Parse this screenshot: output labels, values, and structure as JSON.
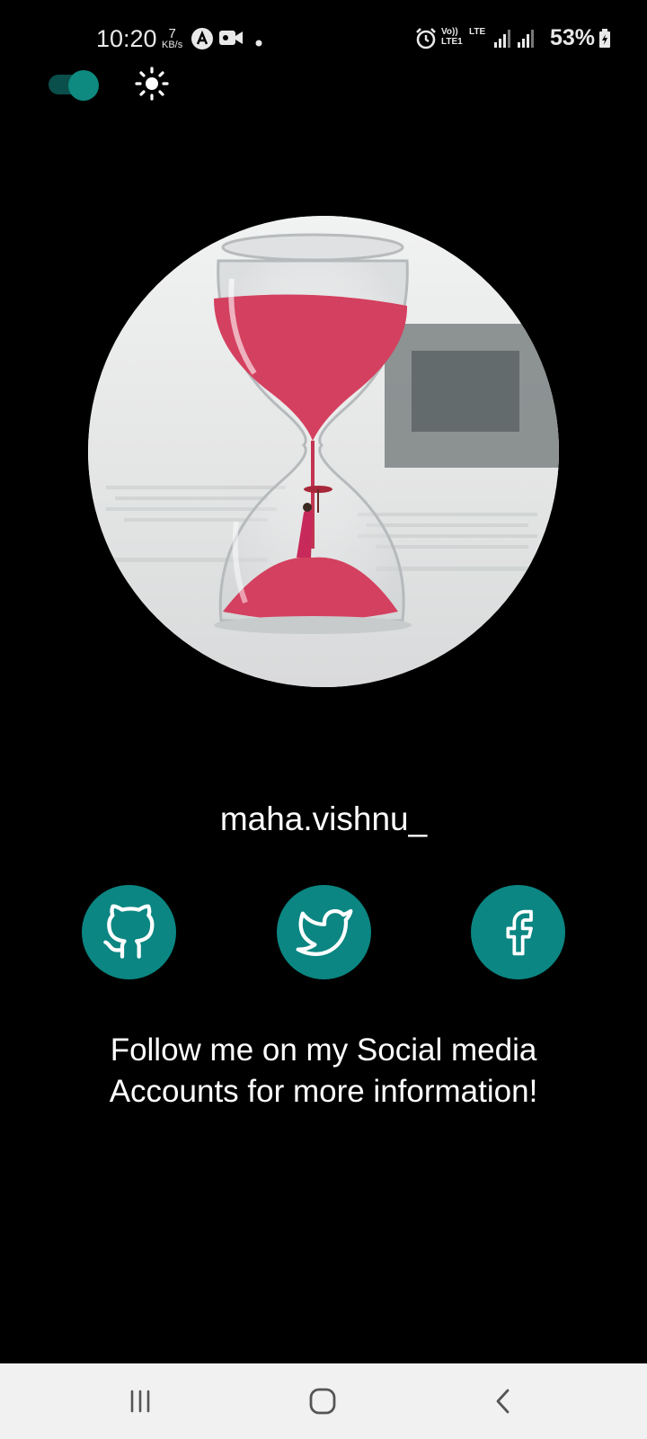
{
  "status_bar": {
    "time": "10:20",
    "speed_value": "7",
    "speed_unit": "KB/s",
    "battery": "53%",
    "icons": [
      "a-icon",
      "video-icon",
      "dot-icon",
      "alarm-icon",
      "volte-icon",
      "lte-icon",
      "signal-icon",
      "signal-icon",
      "battery-charging-icon"
    ],
    "volte_label": "Vo)) LTE1",
    "lte_label": "LTE"
  },
  "header": {
    "theme_toggle": "on",
    "theme_icon": "sun-icon"
  },
  "profile": {
    "image": "hourglass-photo",
    "username": "maha.vishnu_"
  },
  "social": [
    {
      "name": "GitHub",
      "icon": "github-icon"
    },
    {
      "name": "Twitter",
      "icon": "twitter-icon"
    },
    {
      "name": "Facebook",
      "icon": "facebook-icon"
    }
  ],
  "message": "Follow me on my Social media Accounts for more information!",
  "nav": [
    "recent-apps-icon",
    "home-icon",
    "back-icon"
  ],
  "colors": {
    "accent": "#0b8682",
    "background": "#000000",
    "sand": "#d4405f",
    "nav_bg": "#f1f1f1"
  }
}
